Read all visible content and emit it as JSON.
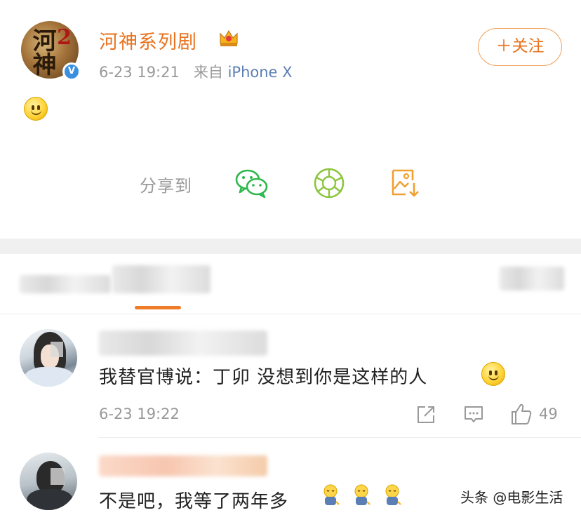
{
  "post": {
    "avatar_glyph": "河神",
    "avatar_num": "2",
    "verified_mark": "V",
    "username": "河神系列剧",
    "time": "6-23 19:21",
    "source_prefix": "来自",
    "source": "iPhone X",
    "follow_label": "＋关注",
    "share_label": "分享到",
    "colors": {
      "accent": "#e8731f",
      "wechat": "#2db84d",
      "moments": "#8cc63f",
      "save": "#f0a030"
    }
  },
  "comments": [
    {
      "text": "我替官博说：丁卯  没想到你是这样的人",
      "time": "6-23 19:22",
      "likes": "49"
    },
    {
      "text": "不是吧，我等了两年多"
    }
  ],
  "watermark": "头条 @电影生活"
}
